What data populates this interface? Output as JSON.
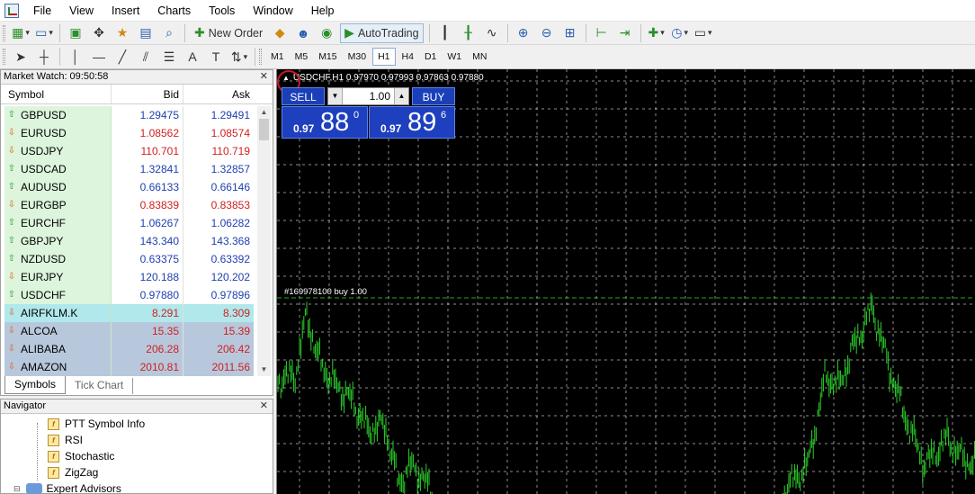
{
  "menu": {
    "items": [
      "File",
      "View",
      "Insert",
      "Charts",
      "Tools",
      "Window",
      "Help"
    ]
  },
  "toolbar": {
    "new_order_label": "New Order",
    "autotrading_label": "AutoTrading"
  },
  "timeframes": {
    "items": [
      "M1",
      "M5",
      "M15",
      "M30",
      "H1",
      "H4",
      "D1",
      "W1",
      "MN"
    ],
    "active": "H1"
  },
  "market_watch": {
    "title": "Market Watch: 09:50:58",
    "columns": [
      "Symbol",
      "Bid",
      "Ask"
    ],
    "rows": [
      {
        "symbol": "GBPUSD",
        "bid": "1.29475",
        "ask": "1.29491",
        "direction": "up",
        "color": "blue"
      },
      {
        "symbol": "EURUSD",
        "bid": "1.08562",
        "ask": "1.08574",
        "direction": "down",
        "color": "red"
      },
      {
        "symbol": "USDJPY",
        "bid": "110.701",
        "ask": "110.719",
        "direction": "down",
        "color": "red"
      },
      {
        "symbol": "USDCAD",
        "bid": "1.32841",
        "ask": "1.32857",
        "direction": "up",
        "color": "blue"
      },
      {
        "symbol": "AUDUSD",
        "bid": "0.66133",
        "ask": "0.66146",
        "direction": "up",
        "color": "blue"
      },
      {
        "symbol": "EURGBP",
        "bid": "0.83839",
        "ask": "0.83853",
        "direction": "down",
        "color": "red"
      },
      {
        "symbol": "EURCHF",
        "bid": "1.06267",
        "ask": "1.06282",
        "direction": "up",
        "color": "blue"
      },
      {
        "symbol": "GBPJPY",
        "bid": "143.340",
        "ask": "143.368",
        "direction": "up",
        "color": "blue"
      },
      {
        "symbol": "NZDUSD",
        "bid": "0.63375",
        "ask": "0.63392",
        "direction": "up",
        "color": "blue"
      },
      {
        "symbol": "EURJPY",
        "bid": "120.188",
        "ask": "120.202",
        "direction": "down",
        "color": "blue"
      },
      {
        "symbol": "USDCHF",
        "bid": "0.97880",
        "ask": "0.97896",
        "direction": "up",
        "color": "blue"
      },
      {
        "symbol": "AIRFKLM.K",
        "bid": "8.291",
        "ask": "8.309",
        "direction": "down",
        "color": "red",
        "style": "sel"
      },
      {
        "symbol": "ALCOA",
        "bid": "15.35",
        "ask": "15.39",
        "direction": "down",
        "color": "red",
        "style": "stock"
      },
      {
        "symbol": "ALIBABA",
        "bid": "206.28",
        "ask": "206.42",
        "direction": "down",
        "color": "red",
        "style": "stock"
      },
      {
        "symbol": "AMAZON",
        "bid": "2010.81",
        "ask": "2011.56",
        "direction": "down",
        "color": "red",
        "style": "stock"
      }
    ],
    "tabs": [
      "Symbols",
      "Tick Chart"
    ]
  },
  "navigator": {
    "title": "Navigator",
    "items": [
      "PTT Symbol Info",
      "RSI",
      "Stochastic",
      "ZigZag",
      "Expert Advisors"
    ]
  },
  "chart": {
    "symbol_info": "USDCHF,H1  0.97970 0.97993 0.97863 0.97880",
    "sell_label": "SELL",
    "buy_label": "BUY",
    "lots": "1.00",
    "sell_price": {
      "small": "0.97",
      "big": "88",
      "sup": "0"
    },
    "buy_price": {
      "small": "0.97",
      "big": "89",
      "sup": "6"
    },
    "order_line_label": "#169978100 buy 1.00",
    "grid_color": "#ffffff",
    "candle_color": "#2cd22c",
    "order_line_color": "#2cd22c"
  }
}
